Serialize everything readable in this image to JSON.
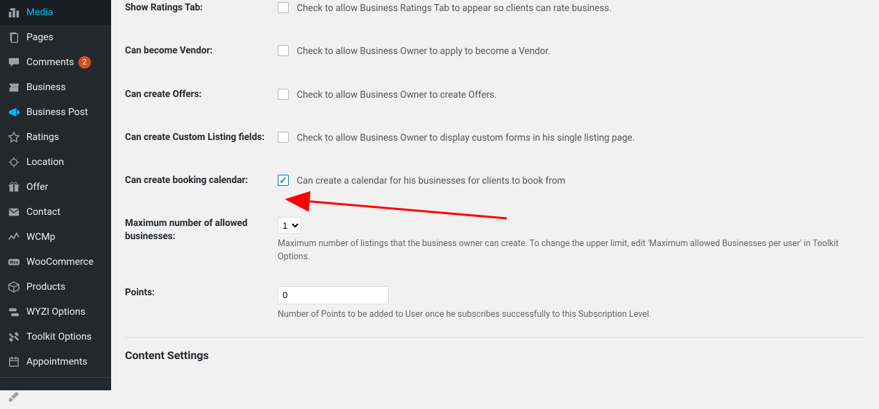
{
  "sidebar": {
    "items": [
      {
        "label": "Media",
        "icon": "media"
      },
      {
        "label": "Pages",
        "icon": "page"
      },
      {
        "label": "Comments",
        "icon": "comment",
        "badge": "2"
      },
      {
        "label": "Business",
        "icon": "store"
      },
      {
        "label": "Business Post",
        "icon": "megaphone"
      },
      {
        "label": "Ratings",
        "icon": "star"
      },
      {
        "label": "Location",
        "icon": "location"
      },
      {
        "label": "Offer",
        "icon": "gift"
      },
      {
        "label": "Contact",
        "icon": "mail"
      },
      {
        "label": "WCMp",
        "icon": "analytics"
      },
      {
        "label": "WooCommerce",
        "icon": "woo"
      },
      {
        "label": "Products",
        "icon": "box"
      },
      {
        "label": "WYZI Options",
        "icon": "toggles"
      },
      {
        "label": "Toolkit Options",
        "icon": "tools"
      },
      {
        "label": "Appointments",
        "icon": "calendar"
      },
      {
        "label": "Appearance",
        "icon": "brush"
      }
    ]
  },
  "form": {
    "show_ratings_tab": {
      "label": "Show Ratings Tab:",
      "desc": "Check to allow Business Ratings Tab to appear so clients can rate business."
    },
    "become_vendor": {
      "label": "Can become Vendor:",
      "desc": "Check to allow Business Owner to apply to become a Vendor."
    },
    "create_offers": {
      "label": "Can create Offers:",
      "desc": "Check to allow Business Owner to create Offers."
    },
    "custom_listing": {
      "label": "Can create Custom Listing fields:",
      "desc": "Check to allow Business Owner to display custom forms in his single listing page."
    },
    "booking_calendar": {
      "label": "Can create booking calendar:",
      "desc": "Can create a calendar for his businesses for clients to book from"
    },
    "max_businesses": {
      "label": "Maximum number of allowed businesses:",
      "value": "1",
      "help": "Maximum number of listings that the business owner can create. To change the upper limit, edit 'Maximum allowed Businesses per user' in Toolkit Options."
    },
    "points": {
      "label": "Points:",
      "value": "0",
      "help": "Number of Points to be added to User once he subscribes successfully to this Subscription Level."
    }
  },
  "section_title": "Content Settings"
}
